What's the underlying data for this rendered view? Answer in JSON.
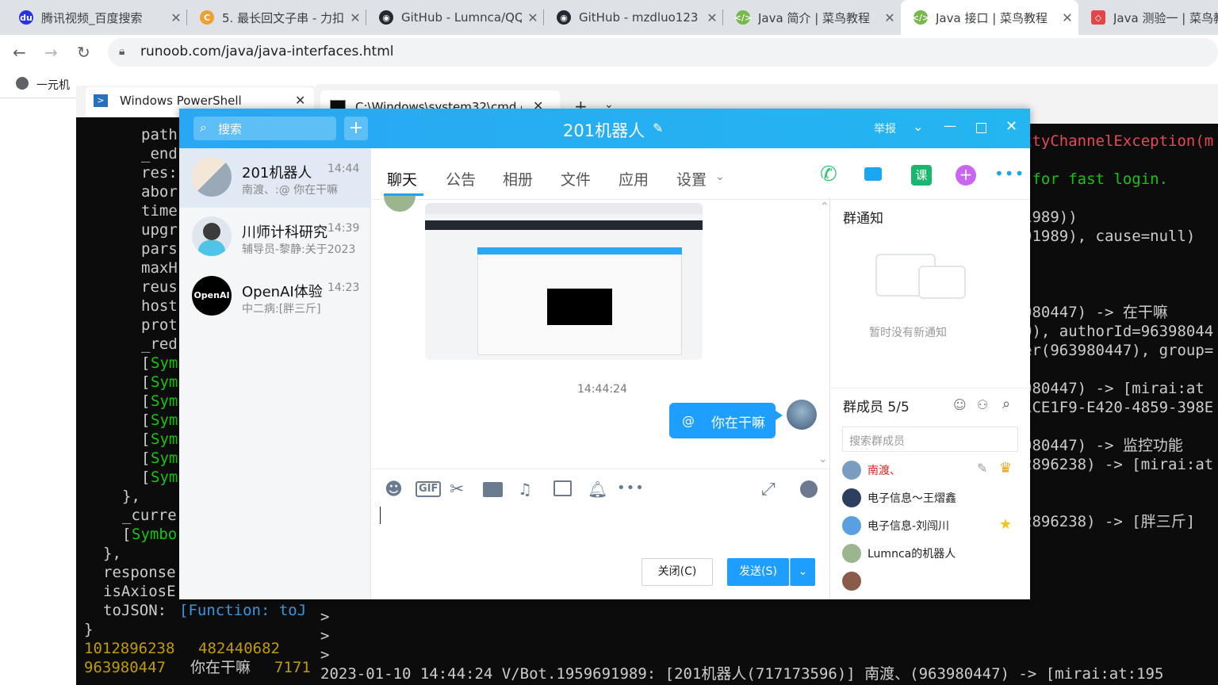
{
  "browser": {
    "tabs": [
      {
        "title": "腾讯视频_百度搜索",
        "icon": "baidu-icon",
        "color": "#2932e1"
      },
      {
        "title": "5. 最长回文子串 - 力扣",
        "icon": "leetcode-icon",
        "color": "#f0a030"
      },
      {
        "title": "GitHub - Lumnca/QQ",
        "icon": "github-icon",
        "color": "#24292f"
      },
      {
        "title": "GitHub - mzdluo123",
        "icon": "github-icon",
        "color": "#24292f"
      },
      {
        "title": "Java 简介 | 菜鸟教程",
        "icon": "runoob-icon",
        "color": "#77b84a"
      },
      {
        "title": "Java 接口 | 菜鸟教程",
        "icon": "runoob-icon",
        "color": "#77b84a"
      },
      {
        "title": "Java 测验一 | 菜鸟教",
        "icon": "codepen-icon",
        "color": "#e04848"
      }
    ],
    "url": "runoob.com/java/java-interfaces.html",
    "bookmark": "一元机"
  },
  "powershell": {
    "tab_title": "Windows PowerShell",
    "lines": [
      {
        "text": "path",
        "color": "#cccccc"
      },
      {
        "text": "_end",
        "color": "#cccccc"
      },
      {
        "text": "res:",
        "color": "#cccccc"
      },
      {
        "text": "abor",
        "color": "#cccccc"
      },
      {
        "text": "time",
        "color": "#cccccc"
      },
      {
        "text": "upgr",
        "color": "#cccccc"
      },
      {
        "text": "pars",
        "color": "#cccccc"
      },
      {
        "text": "maxH",
        "color": "#cccccc"
      },
      {
        "text": "reus",
        "color": "#cccccc"
      },
      {
        "text": "host",
        "color": "#cccccc"
      },
      {
        "text": "prot",
        "color": "#cccccc"
      },
      {
        "text": "_red",
        "color": "#cccccc"
      }
    ],
    "sym_lines": [
      "[Sym",
      "[Sym",
      "[Sym",
      "[Sym",
      "[Sym",
      "[Sym",
      "[Sym"
    ],
    "tail": {
      "close_brace": "},",
      "current": "_curre",
      "symbol_prefix": "[",
      "symbol": "Symbo",
      "close2": "},",
      "response": "response",
      "isaxios": "isAxiosE",
      "tojson_key": "toJSON: ",
      "tojson_val": "[Function: toJ",
      "close3": "}",
      "num_line_a": "1012896238",
      "num_line_b": "482440682",
      "last_a": "963980447",
      "last_b": "你在干嘛",
      "last_c": "7171"
    }
  },
  "cmd": {
    "tab_title": "C:\\Windows\\system32\\cmd.e",
    "lines": [
      {
        "text": "ttyChannelException(m",
        "color": "#e74856"
      },
      {
        "text": " for fast login.",
        "color": "#16c60c"
      },
      {
        "text": "1989))",
        "color": "#cccccc"
      },
      {
        "text": "91989), cause=null)",
        "color": "#cccccc"
      },
      {
        "text": "980447) -> 在干嘛",
        "color": "#cccccc"
      },
      {
        "text": "0), authorId=96398044",
        "color": "#cccccc"
      },
      {
        "text": "er(963980447), group=",
        "color": "#cccccc"
      },
      {
        "text": "980447) -> [mirai:at",
        "color": "#cccccc"
      },
      {
        "text": "1CE1F9-E420-4859-398E",
        "color": "#cccccc"
      },
      {
        "text": "980447) -> 监控功能",
        "color": "#cccccc"
      },
      {
        "text": "2896238) -> [mirai:at",
        "color": "#cccccc"
      },
      {
        "text": "2896238) -> [胖三斤]",
        "color": "#cccccc"
      }
    ],
    "prompts": [
      ">",
      ">",
      ">"
    ],
    "bottom": "2023-01-10 14:44:24 V/Bot.1959691989: [201机器人(717173596)] 南渡、(963980447) -> [mirai:at:195"
  },
  "qq": {
    "search_placeholder": "搜索",
    "title": "201机器人",
    "report": "举报",
    "conversations": [
      {
        "name": "201机器人",
        "time": "14:44",
        "preview": "南渡、:@    你在干嘛",
        "selected": true
      },
      {
        "name": "川师计科研究",
        "time": "14:39",
        "preview": "辅导员-黎静:关于2023",
        "selected": false
      },
      {
        "name": "OpenAI体验",
        "time": "14:23",
        "preview": "中二病:[胖三斤]",
        "selected": false,
        "avatar_text": "OpenAI"
      }
    ],
    "tabs": [
      "聊天",
      "公告",
      "相册",
      "文件",
      "应用",
      "设置"
    ],
    "header_icons": [
      "phone-icon",
      "video-icon",
      "course-icon",
      "plus-icon",
      "more-icon"
    ],
    "course_label": "课",
    "message": {
      "timestamp": "14:44:24",
      "at": "@",
      "text": "你在干嘛"
    },
    "toolbar": [
      "emoji-icon",
      "gif-icon",
      "scissors-icon",
      "folder-icon",
      "music-icon",
      "image-icon",
      "bell-icon",
      "more-icon"
    ],
    "gif_label": "GIF",
    "close_btn": "关闭(C)",
    "send_btn": "发送(S)",
    "notice_title": "群通知",
    "notice_empty": "暂时没有新通知",
    "members_title": "群成员 5/5",
    "member_search_placeholder": "搜索群成员",
    "members": [
      {
        "name": "南渡、",
        "color": "#e02020"
      },
      {
        "name": "电子信息～王熠鑫",
        "color": "#222222"
      },
      {
        "name": "电子信息-刘闯川",
        "color": "#222222"
      },
      {
        "name": "Lumnca的机器人",
        "color": "#222222"
      },
      {
        "name": "",
        "color": "#222222"
      }
    ]
  },
  "colors": {
    "qq_blue": "#1aa6f0",
    "bubble": "#1e9fff",
    "term_bg": "#0c0c0c",
    "yellow": "#c19c00",
    "cyan": "#3a96dd",
    "green": "#16c60c"
  }
}
